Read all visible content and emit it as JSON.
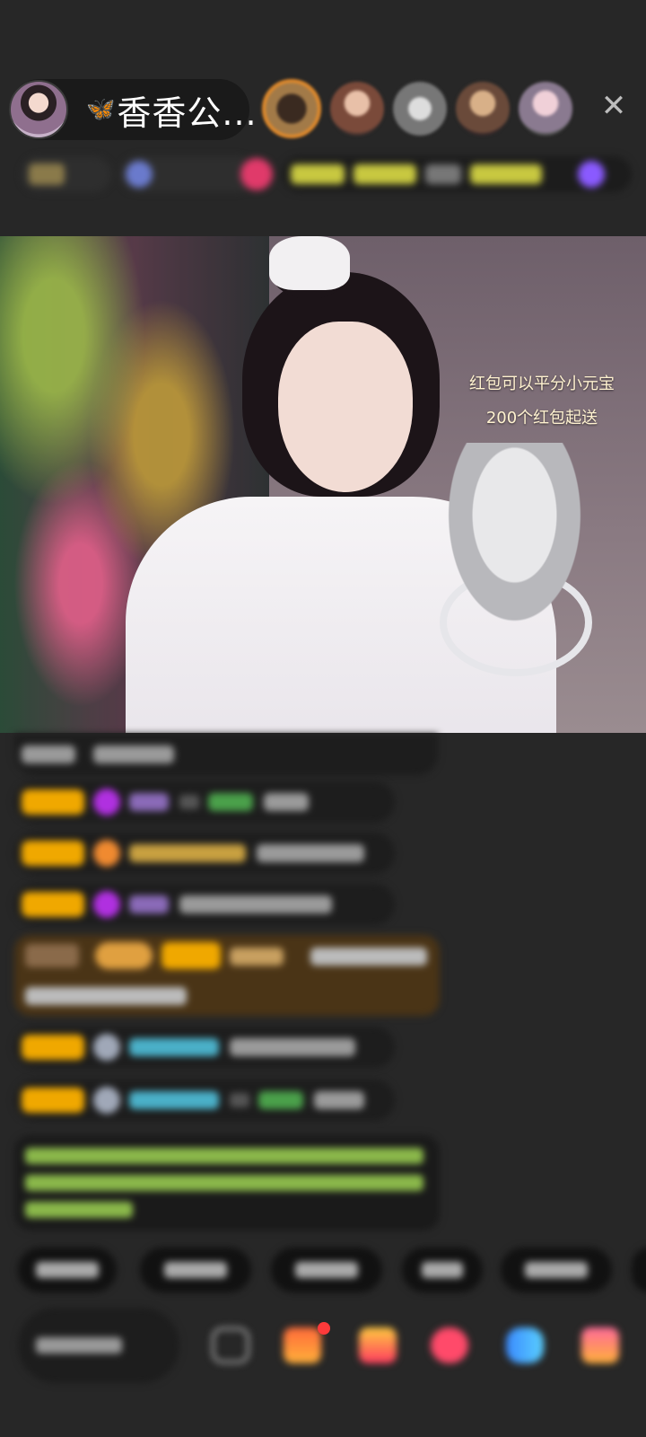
{
  "header": {
    "host_name": "香香公...",
    "butterfly_icon": "🦋",
    "close_icon": "✕"
  },
  "video": {
    "overlay_line_1": "红包可以平分小元宝",
    "overlay_line_2": "200个红包起送"
  },
  "colors": {
    "background": "#272727",
    "level_badge": "#f0a800",
    "accent_orange": "#e08a2c",
    "special_message_bg": "#4a3416",
    "system_text": "#8ab84a"
  },
  "icons": [
    "butterfly-icon",
    "close-icon",
    "emoji-icon",
    "gift-icon",
    "shopping-bag-icon",
    "heart-icon",
    "game-icon",
    "more-icon"
  ]
}
